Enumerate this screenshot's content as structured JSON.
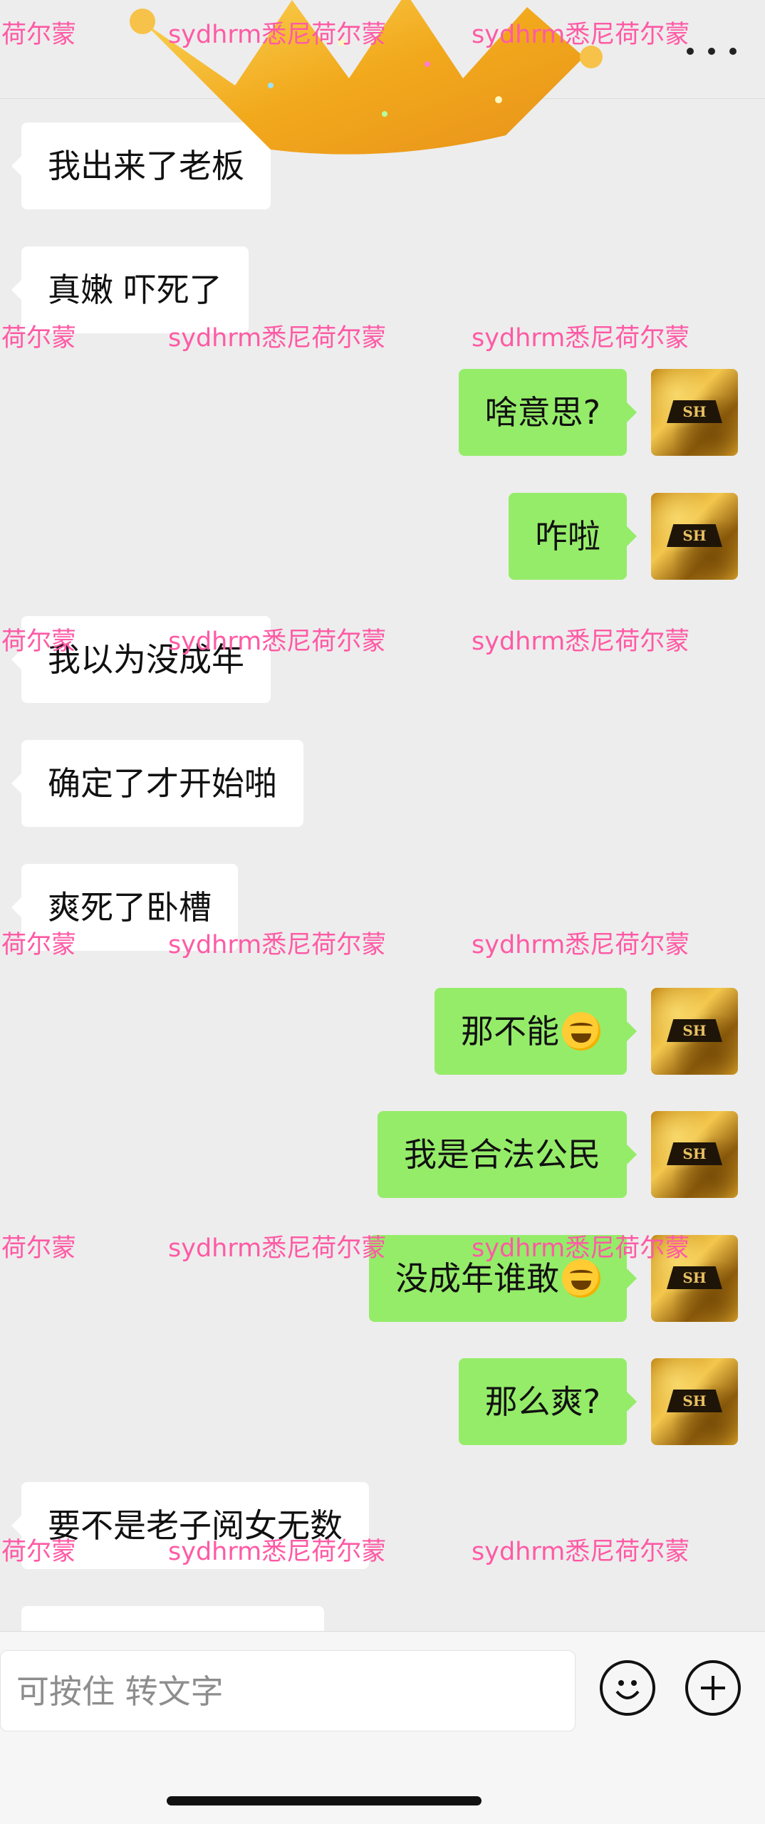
{
  "header": {
    "more_label": "..."
  },
  "messages": [
    {
      "side": "left",
      "text": "我出来了老板"
    },
    {
      "side": "left",
      "text": "真嫩 吓死了"
    },
    {
      "side": "right",
      "text": "啥意思?",
      "avatar_text": "SH"
    },
    {
      "side": "right",
      "text": "咋啦",
      "avatar_text": "SH"
    },
    {
      "side": "left",
      "text": "我以为没成年"
    },
    {
      "side": "left",
      "text": "确定了才开始啪"
    },
    {
      "side": "left",
      "text": "爽死了卧槽"
    },
    {
      "side": "right",
      "text": "那不能",
      "emoji": "laughing-crying-emoji",
      "avatar_text": "SH"
    },
    {
      "side": "right",
      "text": "我是合法公民",
      "avatar_text": "SH"
    },
    {
      "side": "right",
      "text": "没成年谁敢",
      "emoji": "laughing-crying-emoji",
      "avatar_text": "SH"
    },
    {
      "side": "right",
      "text": "那么爽?",
      "avatar_text": "SH"
    },
    {
      "side": "left",
      "text": "要不是老子阅女无数"
    },
    {
      "side": "left",
      "text": ""
    }
  ],
  "watermark_text": "sydhrm悉尼荷尔蒙",
  "watermark_partial": "荷尔蒙",
  "input": {
    "placeholder": "可按住 转文字"
  },
  "colors": {
    "background": "#ededed",
    "bubble_in": "#ffffff",
    "bubble_out": "#95ec69",
    "watermark": "#ff5aa5"
  },
  "icons": {
    "emoji_button": "smiley-face-icon",
    "more_button": "plus-circle-icon",
    "header_menu": "more-dots-icon",
    "decoration": "gold-crown-sticker"
  }
}
